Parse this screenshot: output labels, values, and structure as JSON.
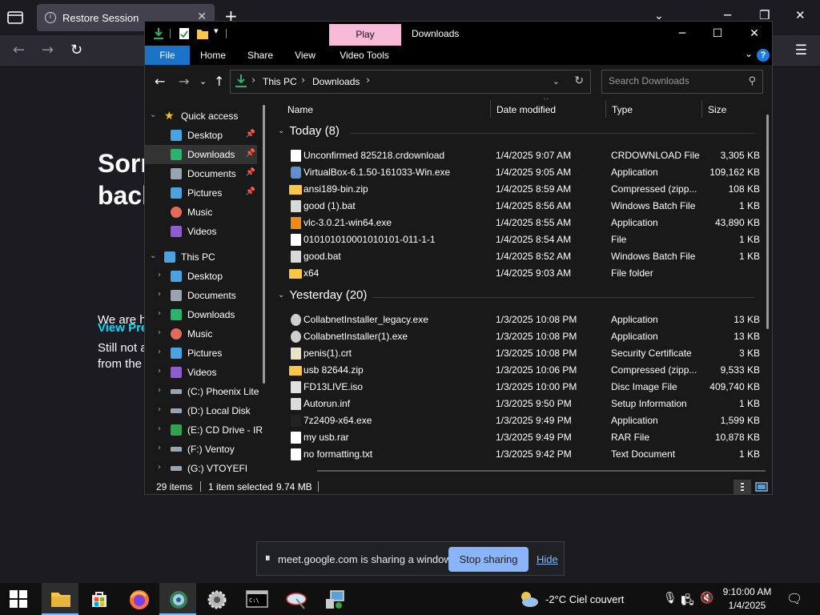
{
  "browser": {
    "tab_title": "Restore Session",
    "heading_lines": [
      "Sorr",
      "back"
    ],
    "para_line1": "We are h",
    "para_line2": "Still not a",
    "para_line3": "from the",
    "link_text": "View Pre"
  },
  "explorer": {
    "context_tab": "Play",
    "window_title": "Downloads",
    "ribbon_tabs": [
      "File",
      "Home",
      "Share",
      "View",
      "Video Tools"
    ],
    "breadcrumbs": [
      "This PC",
      "Downloads"
    ],
    "search_placeholder": "Search Downloads",
    "nav": [
      {
        "label": "Quick access",
        "level": 0,
        "expanded": true,
        "icon": "star-icon",
        "color": "#f5c518",
        "pinned": false,
        "selected": false
      },
      {
        "label": "Desktop",
        "level": 1,
        "icon": "desktop-icon",
        "color": "#4aa3df",
        "pinned": true,
        "selected": false
      },
      {
        "label": "Downloads",
        "level": 1,
        "icon": "download-icon",
        "color": "#29b36b",
        "pinned": true,
        "selected": true
      },
      {
        "label": "Documents",
        "level": 1,
        "icon": "documents-icon",
        "color": "#9aa4b1",
        "pinned": true,
        "selected": false
      },
      {
        "label": "Pictures",
        "level": 1,
        "icon": "pictures-icon",
        "color": "#4aa3df",
        "pinned": true,
        "selected": false
      },
      {
        "label": "Music",
        "level": 1,
        "icon": "music-icon",
        "color": "#e06c5a",
        "pinned": false,
        "selected": false
      },
      {
        "label": "Videos",
        "level": 1,
        "icon": "videos-icon",
        "color": "#8e5bd0",
        "pinned": false,
        "selected": false
      },
      {
        "label": "This PC",
        "level": 0,
        "expanded": true,
        "icon": "computer-icon",
        "color": "#4aa3df",
        "pinned": false,
        "selected": false
      },
      {
        "label": "Desktop",
        "level": 1,
        "icon": "desktop-icon",
        "color": "#4aa3df",
        "pinned": false,
        "selected": false,
        "chev": true
      },
      {
        "label": "Documents",
        "level": 1,
        "icon": "documents-icon",
        "color": "#9aa4b1",
        "pinned": false,
        "selected": false,
        "chev": true
      },
      {
        "label": "Downloads",
        "level": 1,
        "icon": "download-icon",
        "color": "#29b36b",
        "pinned": false,
        "selected": false,
        "chev": true
      },
      {
        "label": "Music",
        "level": 1,
        "icon": "music-icon",
        "color": "#e06c5a",
        "pinned": false,
        "selected": false,
        "chev": true
      },
      {
        "label": "Pictures",
        "level": 1,
        "icon": "pictures-icon",
        "color": "#4aa3df",
        "pinned": false,
        "selected": false,
        "chev": true
      },
      {
        "label": "Videos",
        "level": 1,
        "icon": "videos-icon",
        "color": "#8e5bd0",
        "pinned": false,
        "selected": false,
        "chev": true
      },
      {
        "label": "(C:) Phoenix Lite",
        "level": 1,
        "icon": "drive-icon",
        "color": "#9aa4b1",
        "pinned": false,
        "selected": false,
        "chev": true
      },
      {
        "label": "(D:) Local Disk",
        "level": 1,
        "icon": "drive-icon",
        "color": "#9aa4b1",
        "pinned": false,
        "selected": false,
        "chev": true
      },
      {
        "label": "(E:) CD Drive - IR",
        "level": 1,
        "icon": "cd-drive-icon",
        "color": "#2fa34f",
        "pinned": false,
        "selected": false,
        "chev": true
      },
      {
        "label": "(F:) Ventoy",
        "level": 1,
        "icon": "drive-icon",
        "color": "#9aa4b1",
        "pinned": false,
        "selected": false,
        "chev": true
      },
      {
        "label": "(G:) VTOYEFI",
        "level": 1,
        "icon": "drive-icon",
        "color": "#9aa4b1",
        "pinned": false,
        "selected": false,
        "chev": true
      }
    ],
    "columns": [
      "Name",
      "Date modified",
      "Type",
      "Size"
    ],
    "groups": [
      {
        "title": "Today (8)",
        "files": [
          {
            "name": "Unconfirmed 825218.crdownload",
            "date": "1/4/2025 9:07 AM",
            "type": "CRDOWNLOAD File",
            "size": "3,305 KB",
            "icon": "file-icon"
          },
          {
            "name": "VirtualBox-6.1.50-161033-Win.exe",
            "date": "1/4/2025 9:05 AM",
            "type": "Application",
            "size": "109,162 KB",
            "icon": "virtualbox-icon"
          },
          {
            "name": "ansi189-bin.zip",
            "date": "1/4/2025 8:59 AM",
            "type": "Compressed (zipp...",
            "size": "108 KB",
            "icon": "zip-icon"
          },
          {
            "name": "good (1).bat",
            "date": "1/4/2025 8:56 AM",
            "type": "Windows Batch File",
            "size": "1 KB",
            "icon": "batch-file-icon"
          },
          {
            "name": "vlc-3.0.21-win64.exe",
            "date": "1/4/2025 8:55 AM",
            "type": "Application",
            "size": "43,890 KB",
            "icon": "vlc-icon"
          },
          {
            "name": "010101010001010101-011-1-1",
            "date": "1/4/2025 8:54 AM",
            "type": "File",
            "size": "1 KB",
            "icon": "file-icon"
          },
          {
            "name": "good.bat",
            "date": "1/4/2025 8:52 AM",
            "type": "Windows Batch File",
            "size": "1 KB",
            "icon": "batch-file-icon"
          },
          {
            "name": "x64",
            "date": "1/4/2025 9:03 AM",
            "type": "File folder",
            "size": "",
            "icon": "folder-icon"
          }
        ]
      },
      {
        "title": "Yesterday (20)",
        "files": [
          {
            "name": "CollabnetInstaller_legacy.exe",
            "date": "1/3/2025 10:08 PM",
            "type": "Application",
            "size": "13 KB",
            "icon": "installer-icon"
          },
          {
            "name": "CollabnetInstaller(1).exe",
            "date": "1/3/2025 10:08 PM",
            "type": "Application",
            "size": "13 KB",
            "icon": "installer-icon"
          },
          {
            "name": "penis(1).crt",
            "date": "1/3/2025 10:08 PM",
            "type": "Security Certificate",
            "size": "3 KB",
            "icon": "certificate-icon"
          },
          {
            "name": "usb 82644.zip",
            "date": "1/3/2025 10:06 PM",
            "type": "Compressed (zipp...",
            "size": "9,533 KB",
            "icon": "zip-icon"
          },
          {
            "name": "FD13LIVE.iso",
            "date": "1/3/2025 10:00 PM",
            "type": "Disc Image File",
            "size": "409,740 KB",
            "icon": "disc-image-icon"
          },
          {
            "name": "Autorun.inf",
            "date": "1/3/2025 9:50 PM",
            "type": "Setup Information",
            "size": "1 KB",
            "icon": "setup-info-icon"
          },
          {
            "name": "7z2409-x64.exe",
            "date": "1/3/2025 9:49 PM",
            "type": "Application",
            "size": "1,599 KB",
            "icon": "7zip-icon"
          },
          {
            "name": "my usb.rar",
            "date": "1/3/2025 9:49 PM",
            "type": "RAR File",
            "size": "10,878 KB",
            "icon": "file-icon"
          },
          {
            "name": "no formatting.txt",
            "date": "1/3/2025 9:42 PM",
            "type": "Text Document",
            "size": "1 KB",
            "icon": "text-file-icon"
          }
        ]
      }
    ],
    "status": {
      "items": "29 items",
      "selected": "1 item selected",
      "size": "9.74 MB"
    }
  },
  "sharing": {
    "message": "meet.google.com is sharing a window.",
    "stop_label": "Stop sharing",
    "hide_label": "Hide"
  },
  "taskbar": {
    "weather": "-2°C  Ciel couvert",
    "time": "9:10:00 AM",
    "date": "1/4/2025"
  }
}
